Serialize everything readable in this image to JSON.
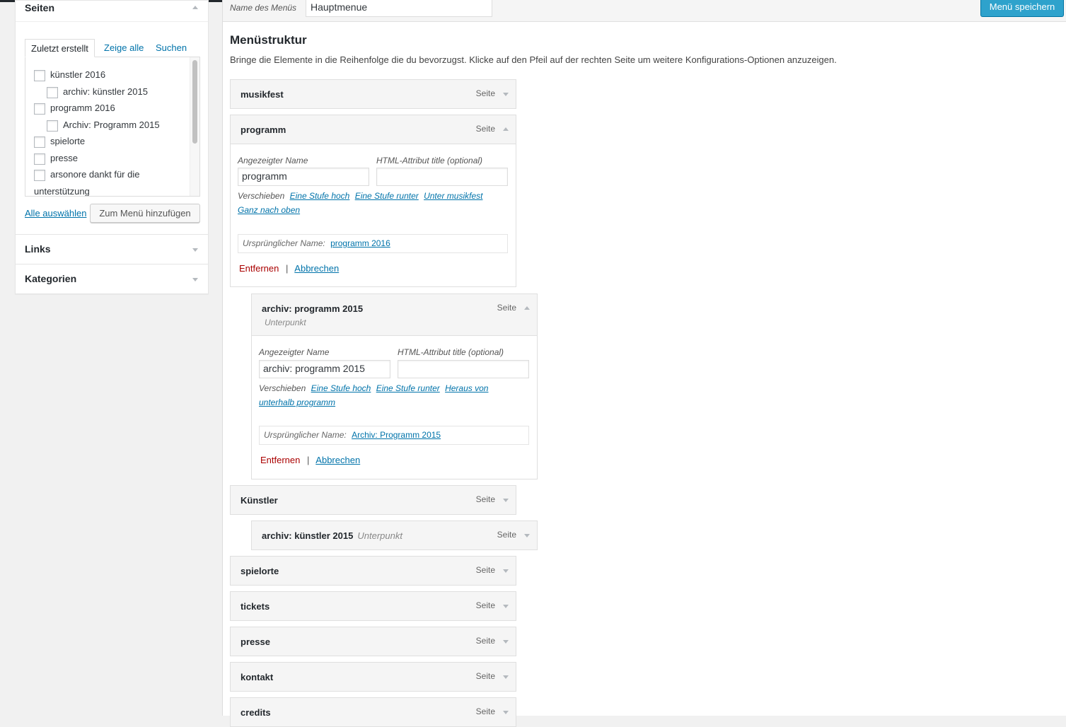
{
  "sidebar": {
    "pages_box": {
      "title": "Seiten",
      "tabs": [
        "Zuletzt erstellt",
        "Zeige alle",
        "Suchen"
      ],
      "items": [
        {
          "label": "künstler 2016",
          "child": false
        },
        {
          "label": "archiv: künstler 2015",
          "child": true
        },
        {
          "label": "programm 2016",
          "child": false
        },
        {
          "label": "Archiv: Programm 2015",
          "child": true
        },
        {
          "label": "spielorte",
          "child": false
        },
        {
          "label": "presse",
          "child": false
        },
        {
          "label": "arsonore dankt für die",
          "child": false
        },
        {
          "label": "unterstützung",
          "child": false
        }
      ],
      "select_all": "Alle auswählen",
      "add_button": "Zum Menü hinzufügen"
    },
    "links_box": {
      "title": "Links"
    },
    "categories_box": {
      "title": "Kategorien"
    }
  },
  "header": {
    "menu_name_label": "Name des Menüs",
    "menu_name_value": "Hauptmenue",
    "save_button": "Menü speichern"
  },
  "structure": {
    "title": "Menüstruktur",
    "description": "Bringe die Elemente in die Reihenfolge die du bevorzugst. Klicke auf den Pfeil auf der rechten Seite um weitere Konfigurations-Optionen anzuzeigen.",
    "items": {
      "musikfest": {
        "name": "musikfest",
        "type": "Seite"
      },
      "programm": {
        "name": "programm",
        "type": "Seite",
        "label_nav": "Angezeigter Name",
        "label_title": "HTML-Attribut title (optional)",
        "nav_value": "programm",
        "title_value": "",
        "move_label": "Verschieben",
        "move_links": [
          "Eine Stufe hoch",
          "Eine Stufe runter",
          "Unter musikfest",
          "Ganz nach oben"
        ],
        "orig_label": "Ursprünglicher Name:",
        "orig_link": "programm 2016",
        "remove": "Entfernen",
        "separator": "|",
        "cancel": "Abbrechen"
      },
      "archiv_programm": {
        "name": "archiv: programm 2015",
        "type": "Seite",
        "subitem": "Unterpunkt",
        "label_nav": "Angezeigter Name",
        "label_title": "HTML-Attribut title (optional)",
        "nav_value": "archiv: programm 2015",
        "title_value": "",
        "move_label": "Verschieben",
        "move_links": [
          "Eine Stufe hoch",
          "Eine Stufe runter",
          "Heraus von",
          "unterhalb programm"
        ],
        "orig_label": "Ursprünglicher Name:",
        "orig_link": "Archiv: Programm 2015",
        "remove": "Entfernen",
        "separator": "|",
        "cancel": "Abbrechen"
      },
      "kuenstler": {
        "name": "Künstler",
        "type": "Seite"
      },
      "archiv_kuenstler": {
        "name": "archiv: künstler 2015",
        "type": "Seite",
        "subitem": "Unterpunkt"
      },
      "spielorte": {
        "name": "spielorte",
        "type": "Seite"
      },
      "tickets": {
        "name": "tickets",
        "type": "Seite"
      },
      "presse": {
        "name": "presse",
        "type": "Seite"
      },
      "kontakt": {
        "name": "kontakt",
        "type": "Seite"
      },
      "credits": {
        "name": "credits",
        "type": "Seite"
      }
    }
  },
  "icons": {
    "collapse": "arrow-up-icon",
    "expand": "arrow-down-icon",
    "checkbox": "checkbox-icon"
  },
  "colors": {
    "primary": "#0073aa",
    "save_button": "#2ea2cc",
    "remove": "#aa0000",
    "background": "#f1f1f1"
  }
}
